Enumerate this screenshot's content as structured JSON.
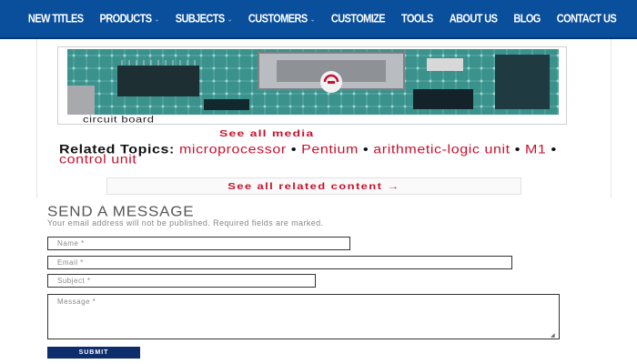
{
  "nav": {
    "items": [
      {
        "label": "NEW TITLES",
        "has_dropdown": false
      },
      {
        "label": "PRODUCTS",
        "has_dropdown": true
      },
      {
        "label": "SUBJECTS",
        "has_dropdown": true
      },
      {
        "label": "CUSTOMERS",
        "has_dropdown": true
      },
      {
        "label": "CUSTOMIZE",
        "has_dropdown": false
      },
      {
        "label": "TOOLS",
        "has_dropdown": false
      },
      {
        "label": "ABOUT US",
        "has_dropdown": false
      },
      {
        "label": "BLOG",
        "has_dropdown": false
      },
      {
        "label": "CONTACT US",
        "has_dropdown": false
      }
    ],
    "dropdown_glyph": "⌄",
    "bg_color": "#0a4f9c"
  },
  "article": {
    "media_caption": "circuit board",
    "see_all_media": "See all media",
    "related_label": "Related Topics:",
    "topics": [
      "microprocessor",
      "Pentium",
      "arithmetic-logic unit",
      "M1",
      "control unit"
    ],
    "topic_separator": "•",
    "see_all_related": "See all related content →",
    "link_color": "#c8102e"
  },
  "form": {
    "title": "SEND A MESSAGE",
    "note": "Your email address will not be published. Required fields are marked.",
    "name_placeholder": "Name *",
    "email_placeholder": "Email *",
    "subject_placeholder": "Subject *",
    "message_placeholder": "Message *",
    "submit_label": "SUBMIT",
    "submit_color": "#0d2d6b"
  }
}
